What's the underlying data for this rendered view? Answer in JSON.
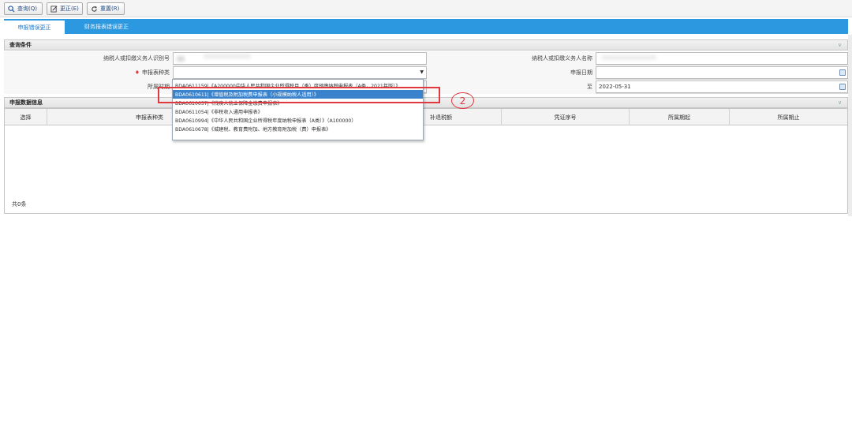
{
  "toolbar": {
    "query_label": "查询(Q)",
    "correct_label": "更正(E)",
    "reset_label": "重置(R)"
  },
  "tabs": [
    {
      "label": "申报错误更正",
      "active": true
    },
    {
      "label": "财务报表错误更正",
      "active": false
    }
  ],
  "query_section": {
    "title": "查询条件",
    "fields": {
      "taxpayer_id_label": "纳税人或扣缴义务人识别号",
      "taxpayer_name_label": "纳税人或扣缴义务人名称",
      "declaration_type_label": "申报表种类",
      "declaration_date_label": "申报日期",
      "period_label": "所属时期",
      "to_label": "至",
      "period_end_value": "2022-05-31"
    }
  },
  "dropdown": {
    "options": [
      "BDA0611159|《A200000中华人民共和国企业所得税月（季）度预缴纳税申报表（A类，2021年版）》",
      "BDA0610611|《增值税及附加税费申报表（小规模纳税人适用）》",
      "BDA0610657|《残疾人就业保障金缴费申报表》",
      "BDA0611054|《非税收入通用申报表》",
      "BDA0610994|《中华人民共和国企业所得税年度纳税申报表（A类）》（A100000）",
      "BDA0610678|《城建税、教育费附加、地方教育附加税（费）申报表》"
    ],
    "selected_index": 1
  },
  "data_section": {
    "title": "申报数据信息",
    "columns": [
      "选择",
      "申报表种类",
      "补退税额",
      "凭证序号",
      "所属期起",
      "所属期止"
    ],
    "total": "共0条"
  },
  "annotation": {
    "marker": "2"
  },
  "colors": {
    "tab_blue": "#2b98df",
    "selected_option": "#3a83cc",
    "annotation_red": "#e0383d"
  }
}
